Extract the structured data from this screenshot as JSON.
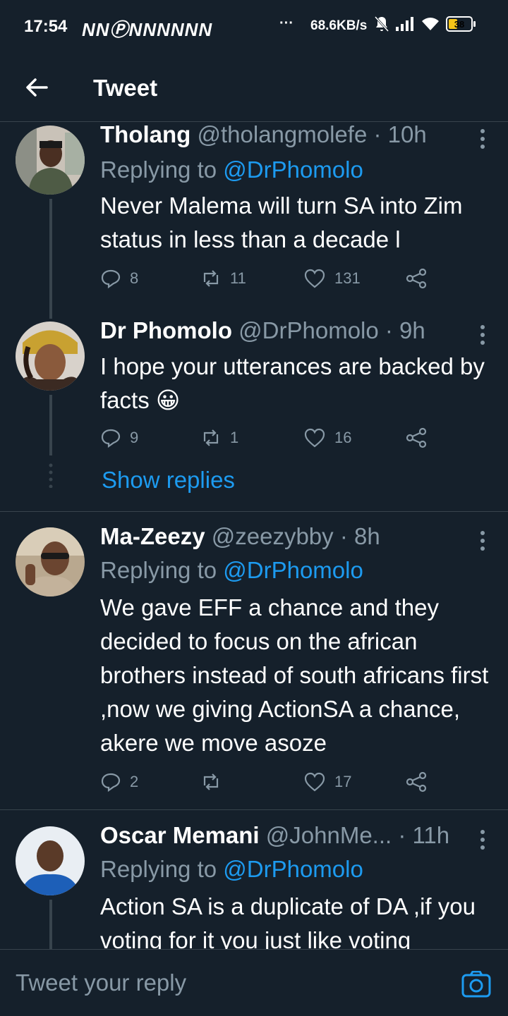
{
  "status_bar": {
    "time": "17:54",
    "notif_letters": "NNⓅNNNNNN",
    "dots": "···",
    "speed": "68.6KB/s",
    "battery": "38"
  },
  "app_bar": {
    "title": "Tweet"
  },
  "tweets": [
    {
      "name": "Tholang",
      "handle": "@tholangmolefe · 10h",
      "reply_prefix": "Replying to ",
      "reply_to": "@DrPhomolo",
      "text": "Never Malema will turn SA into Zim status in less than a decade l",
      "replies": "8",
      "retweets": "11",
      "likes": "131"
    },
    {
      "name": "Dr Phomolo",
      "handle": "@DrPhomolo · 9h",
      "text": "I hope your utterances are backed by facts 😀",
      "replies": "9",
      "retweets": "1",
      "likes": "16",
      "show_replies": "Show replies"
    },
    {
      "name": "Ma-Zeezy",
      "handle": "@zeezybby · 8h",
      "reply_prefix": "Replying to ",
      "reply_to": "@DrPhomolo",
      "text": "We gave EFF a chance and they decided to focus on the african brothers instead of south africans first ,now we giving ActionSA a chance, akere we move asoze",
      "replies": "2",
      "retweets": "",
      "likes": "17"
    },
    {
      "name": "Oscar Memani",
      "handle": "@JohnMe... · 11h",
      "reply_prefix": "Replying to ",
      "reply_to": "@DrPhomolo",
      "text": "Action SA is a duplicate of DA ,if you voting for it you just like voting"
    }
  ],
  "composer": {
    "placeholder": "Tweet your reply"
  },
  "colors": {
    "background": "#15202b",
    "accent": "#1d9bf0",
    "muted": "#8899a6",
    "border": "#38444d"
  }
}
